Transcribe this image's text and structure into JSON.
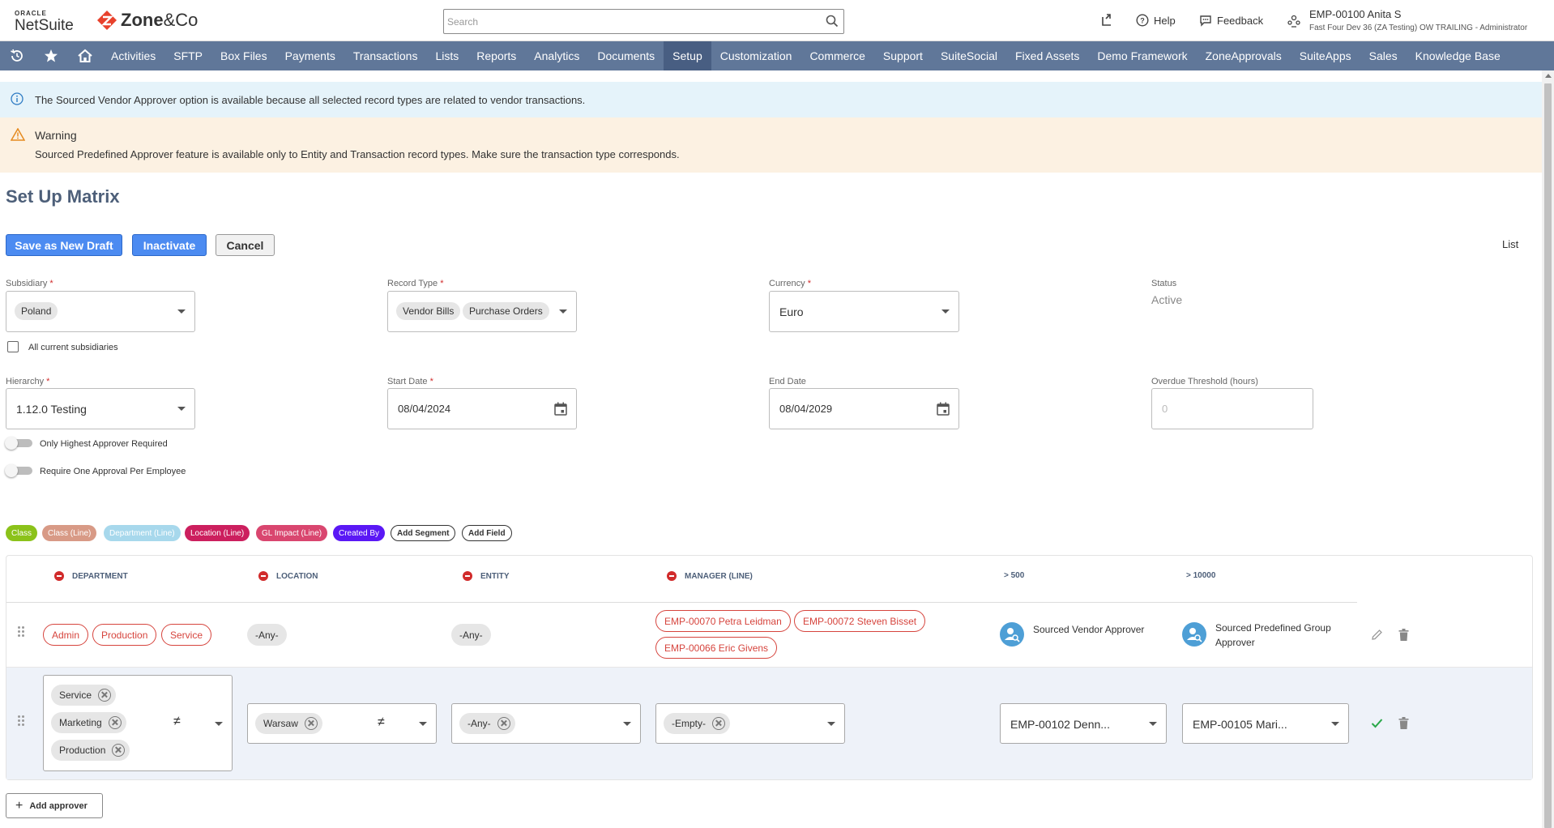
{
  "header": {
    "oracle_label": "ORACLE",
    "netsuite_label": "NetSuite",
    "zone_brand": "Zone",
    "zone_suffix": "&Co",
    "search_placeholder": "Search",
    "help_label": "Help",
    "feedback_label": "Feedback",
    "user_name": "EMP-00100 Anita S",
    "user_role": "Fast Four Dev 36 (ZA Testing) OW TRAILING - Administrator"
  },
  "nav": {
    "items": [
      "Activities",
      "SFTP",
      "Box Files",
      "Payments",
      "Transactions",
      "Lists",
      "Reports",
      "Analytics",
      "Documents",
      "Setup",
      "Customization",
      "Commerce",
      "Support",
      "SuiteSocial",
      "Fixed Assets",
      "Demo Framework",
      "ZoneApprovals",
      "SuiteApps",
      "Sales",
      "Knowledge Base"
    ],
    "active": "Setup"
  },
  "banners": {
    "info_text": "The Sourced Vendor Approver option is available because all selected record types are related to vendor transactions.",
    "warning_title": "Warning",
    "warning_text": "Sourced Predefined Approver feature is available only to Entity and Transaction record types. Make sure the transaction type corresponds."
  },
  "page": {
    "title": "Set Up Matrix",
    "save_draft_label": "Save as New Draft",
    "inactivate_label": "Inactivate",
    "cancel_label": "Cancel",
    "list_link": "List"
  },
  "form": {
    "subsidiary_label": "Subsidiary",
    "subsidiary_value": "Poland",
    "all_subsidiaries_label": "All current subsidiaries",
    "record_type_label": "Record Type",
    "record_type_values": [
      "Vendor Bills",
      "Purchase Orders"
    ],
    "currency_label": "Currency",
    "currency_value": "Euro",
    "status_label": "Status",
    "status_value": "Active",
    "hierarchy_label": "Hierarchy",
    "hierarchy_value": "1.12.0 Testing",
    "start_date_label": "Start Date",
    "start_date_value": "08/04/2024",
    "end_date_label": "End Date",
    "end_date_value": "08/04/2029",
    "overdue_label": "Overdue Threshold (hours)",
    "overdue_placeholder": "0",
    "highest_approver_label": "Only Highest Approver Required",
    "one_approval_label": "Require One Approval Per Employee"
  },
  "segments": {
    "chips": [
      {
        "label": "Class",
        "color": "#8bc21a"
      },
      {
        "label": "Class (Line)",
        "color": "#d89a86"
      },
      {
        "label": "Department (Line)",
        "color": "#a7d8ec"
      },
      {
        "label": "Location (Line)",
        "color": "#cc1f5e"
      },
      {
        "label": "GL Impact (Line)",
        "color": "#d9466f"
      },
      {
        "label": "Created By",
        "color": "#5a18f5"
      }
    ],
    "add_segment_label": "Add Segment",
    "add_field_label": "Add Field"
  },
  "matrix": {
    "headers": [
      "DEPARTMENT",
      "LOCATION",
      "ENTITY",
      "MANAGER (LINE)",
      "> 500",
      "> 10000"
    ],
    "row1": {
      "departments": [
        "Admin",
        "Production",
        "Service"
      ],
      "location": "-Any-",
      "entity": "-Any-",
      "managers": [
        "EMP-00070 Petra Leidman",
        "EMP-00072 Steven Bisset",
        "EMP-00066 Eric Givens"
      ],
      "approver_500": "Sourced Vendor Approver",
      "approver_10000": "Sourced Predefined Group Approver"
    },
    "row2": {
      "departments": [
        "Service",
        "Marketing",
        "Production"
      ],
      "location": "Warsaw",
      "entity": "-Any-",
      "manager": "-Empty-",
      "approver_500": "EMP-00102 Denn...",
      "approver_10000": "EMP-00105 Mari..."
    },
    "add_approver_label": "Add approver"
  }
}
